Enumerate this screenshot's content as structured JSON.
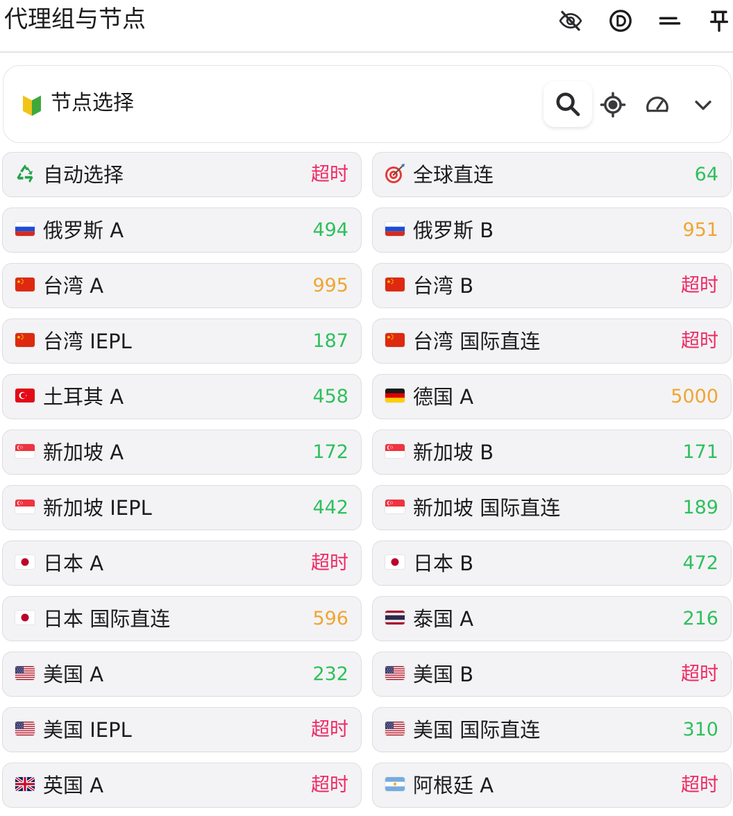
{
  "window": {
    "title": "代理组与节点",
    "icons": [
      "eye-slash-icon",
      "d-circle-icon",
      "minimize-icon",
      "pin-icon"
    ]
  },
  "group": {
    "name": "节点选择",
    "icon": "beginner-badge-icon",
    "tools": [
      "search-icon",
      "locate-icon",
      "speed-test-icon",
      "chevron-down-icon"
    ]
  },
  "colors": {
    "fast": "#2ec05c",
    "medium": "#f0a532",
    "timeout": "#ee2a64"
  },
  "nodes": [
    {
      "name": "自动选择",
      "icon": "recycle",
      "delay": "超时",
      "status": "timeout"
    },
    {
      "name": "全球直连",
      "icon": "target",
      "delay": "64",
      "status": "fast"
    },
    {
      "name": "俄罗斯 A",
      "icon": "ru",
      "delay": "494",
      "status": "fast"
    },
    {
      "name": "俄罗斯 B",
      "icon": "ru",
      "delay": "951",
      "status": "medium"
    },
    {
      "name": "台湾 A",
      "icon": "tw",
      "delay": "995",
      "status": "medium"
    },
    {
      "name": "台湾 B",
      "icon": "tw",
      "delay": "超时",
      "status": "timeout"
    },
    {
      "name": "台湾 IEPL",
      "icon": "tw",
      "delay": "187",
      "status": "fast"
    },
    {
      "name": "台湾 国际直连",
      "icon": "tw",
      "delay": "超时",
      "status": "timeout"
    },
    {
      "name": "土耳其 A",
      "icon": "tr",
      "delay": "458",
      "status": "fast"
    },
    {
      "name": "德国 A",
      "icon": "de",
      "delay": "5000",
      "status": "medium"
    },
    {
      "name": "新加坡 A",
      "icon": "sg",
      "delay": "172",
      "status": "fast"
    },
    {
      "name": "新加坡 B",
      "icon": "sg",
      "delay": "171",
      "status": "fast"
    },
    {
      "name": "新加坡 IEPL",
      "icon": "sg",
      "delay": "442",
      "status": "fast"
    },
    {
      "name": "新加坡 国际直连",
      "icon": "sg",
      "delay": "189",
      "status": "fast"
    },
    {
      "name": "日本 A",
      "icon": "jp",
      "delay": "超时",
      "status": "timeout"
    },
    {
      "name": "日本 B",
      "icon": "jp",
      "delay": "472",
      "status": "fast"
    },
    {
      "name": "日本 国际直连",
      "icon": "jp",
      "delay": "596",
      "status": "medium"
    },
    {
      "name": "泰国 A",
      "icon": "th",
      "delay": "216",
      "status": "fast"
    },
    {
      "name": "美国 A",
      "icon": "us",
      "delay": "232",
      "status": "fast"
    },
    {
      "name": "美国 B",
      "icon": "us",
      "delay": "超时",
      "status": "timeout"
    },
    {
      "name": "美国 IEPL",
      "icon": "us",
      "delay": "超时",
      "status": "timeout"
    },
    {
      "name": "美国 国际直连",
      "icon": "us",
      "delay": "310",
      "status": "fast"
    },
    {
      "name": "英国 A",
      "icon": "gb",
      "delay": "超时",
      "status": "timeout"
    },
    {
      "name": "阿根廷 A",
      "icon": "ar",
      "delay": "超时",
      "status": "timeout"
    }
  ]
}
